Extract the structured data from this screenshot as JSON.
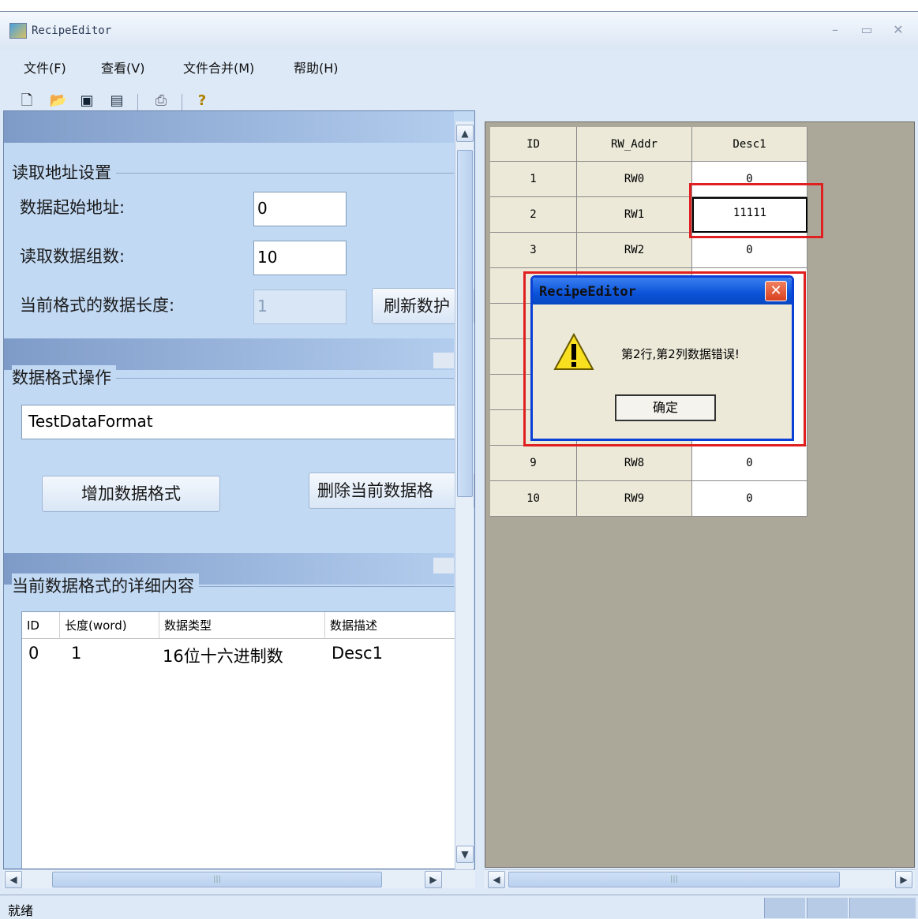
{
  "window": {
    "title": "RecipeEditor"
  },
  "menu": {
    "file": "文件(F)",
    "view": "查看(V)",
    "merge": "文件合并(M)",
    "help": "帮助(H)"
  },
  "read_group": {
    "title": "读取地址设置",
    "start_label": "数据起始地址:",
    "start_value": "0",
    "count_label": "读取数据组数:",
    "count_value": "10",
    "length_label": "当前格式的数据长度:",
    "length_value": "1",
    "refresh_label": "刷新数护"
  },
  "format_group": {
    "title": "数据格式操作",
    "format_value": "TestDataFormat",
    "add_label": "增加数据格式",
    "delete_label": "删除当前数据格"
  },
  "detail_group": {
    "title": "当前数据格式的详细内容",
    "columns": [
      "ID",
      "长度(word)",
      "数据类型",
      "数据描述"
    ],
    "rows": [
      {
        "id": "0",
        "length": "1",
        "type": "16位十六进制数",
        "desc": "Desc1"
      }
    ]
  },
  "grid": {
    "headers": [
      "ID",
      "RW_Addr",
      "Desc1"
    ],
    "rows": [
      {
        "id": "1",
        "addr": "RW0",
        "desc": "0"
      },
      {
        "id": "2",
        "addr": "RW1",
        "desc": "11111"
      },
      {
        "id": "3",
        "addr": "RW2",
        "desc": "0"
      },
      {
        "id": "9",
        "addr": "RW8",
        "desc": "0"
      },
      {
        "id": "10",
        "addr": "RW9",
        "desc": "0"
      }
    ]
  },
  "dialog": {
    "title": "RecipeEditor",
    "message": "第2行,第2列数据错误!",
    "ok": "确定",
    "icon": "warning-icon"
  },
  "status": {
    "text": "就绪"
  },
  "colors": {
    "highlight": "#e02020",
    "dialog_title": "#0a52d8"
  }
}
